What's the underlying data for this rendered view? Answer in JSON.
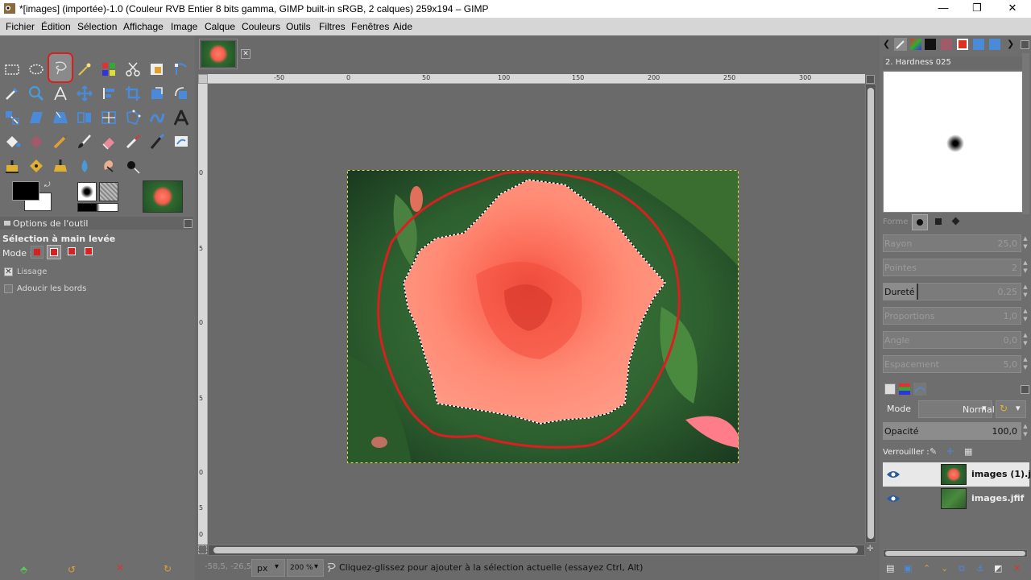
{
  "window": {
    "title": "*[images] (importée)-1.0 (Couleur RVB Entier 8 bits gamma, GIMP built-in sRGB, 2 calques) 259x194 – GIMP",
    "minimize": "—",
    "maximize": "❐",
    "close": "✕"
  },
  "menu": [
    "Fichier",
    "Édition",
    "Sélection",
    "Affichage",
    "Image",
    "Calque",
    "Couleurs",
    "Outils",
    "Filtres",
    "Fenêtres",
    "Aide"
  ],
  "tool_options": {
    "tab_label": "Options de l'outil",
    "tool_name": "Sélection à main levée",
    "mode_label": "Mode :",
    "lissage_label": "Lissage",
    "lissage_checked": true,
    "adoucir_label": "Adoucir les bords",
    "adoucir_checked": false
  },
  "ruler_h_labels": [
    "-50",
    "0",
    "50",
    "100",
    "150",
    "200",
    "250",
    "300"
  ],
  "ruler_v_labels": [
    "0",
    "5",
    "0",
    "5",
    "0",
    "5",
    "0"
  ],
  "brush_panel": {
    "brush_name": "2. Hardness 025",
    "forme_label": "Forme :",
    "sliders": [
      {
        "label": "Rayon",
        "value": "25,0",
        "fill": 0.0
      },
      {
        "label": "Pointes",
        "value": "2",
        "fill": 0.0
      },
      {
        "label": "Dureté",
        "value": "0,25",
        "fill": 0.25
      },
      {
        "label": "Proportions",
        "value": "1,0",
        "fill": 0.0
      },
      {
        "label": "Angle",
        "value": "0,0",
        "fill": 0.0
      },
      {
        "label": "Espacement",
        "value": "5,0",
        "fill": 0.0
      }
    ]
  },
  "layers_panel": {
    "mode_label": "Mode",
    "mode_value": "Normal",
    "opacity_label": "Opacité",
    "opacity_value": "100,0",
    "lock_label": "Verrouiller :",
    "layers": [
      {
        "name": "images (1).jfif",
        "visible": true,
        "active": true
      },
      {
        "name": "images.jfif",
        "visible": true,
        "active": false
      }
    ]
  },
  "status": {
    "coords": "-58,5, -26,5",
    "unit": "px",
    "zoom": "200 %",
    "message": "Cliquez-glissez pour ajouter à la sélection actuelle (essayez Ctrl, Alt)"
  },
  "colors": {
    "selection_highlight": "#d82020",
    "fg_color": "#000000",
    "bg_color": "#ffffff"
  },
  "icons": [
    "rect-select-icon",
    "ellipse-select-icon",
    "free-select-icon",
    "fuzzy-select-icon",
    "select-by-color-icon",
    "scissors-icon",
    "foreground-select-icon",
    "paths-icon",
    "color-picker-icon",
    "zoom-icon",
    "measure-icon",
    "move-icon",
    "align-icon",
    "crop-icon",
    "unified-transform-icon",
    "rotate-icon",
    "scale-icon",
    "shear-icon",
    "flip-icon",
    "perspective-icon",
    "warp-icon",
    "text-icon",
    "bucket-fill-icon",
    "blend-icon",
    "pencil-icon",
    "paintbrush-icon",
    "eraser-icon",
    "airbrush-icon",
    "ink-icon",
    "heal-icon",
    "clone-icon",
    "smudge-icon",
    "dodge-burn-icon",
    "color-tool-icon",
    "mypaint-brush-icon",
    "eye-icon"
  ]
}
